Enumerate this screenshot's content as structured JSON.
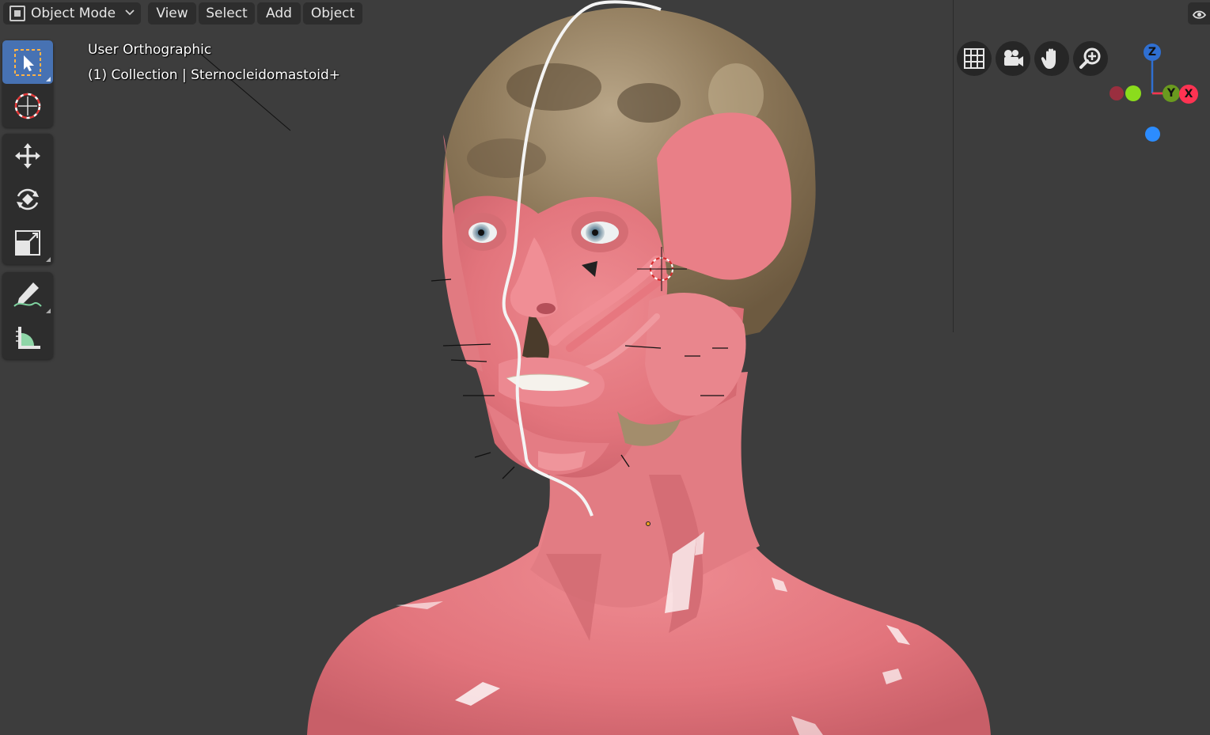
{
  "header": {
    "mode_label": "Object Mode",
    "menus": [
      "View",
      "Select",
      "Add",
      "Object"
    ]
  },
  "viewport": {
    "view_name": "User Orthographic",
    "collection_info": "(1) Collection | Sternocleidomastoid+"
  },
  "toolbar": {
    "tools": [
      {
        "name": "select-box",
        "icon": "select-box-icon",
        "active": true
      },
      {
        "name": "cursor",
        "icon": "cursor-icon",
        "active": false
      },
      {
        "name": "move",
        "icon": "move-icon",
        "active": false
      },
      {
        "name": "rotate",
        "icon": "rotate-icon",
        "active": false
      },
      {
        "name": "scale",
        "icon": "scale-icon",
        "active": false
      },
      {
        "name": "annotate",
        "icon": "annotate-icon",
        "active": false
      },
      {
        "name": "measure",
        "icon": "measure-icon",
        "active": false
      }
    ]
  },
  "navigation": {
    "buttons": [
      "grid-icon",
      "camera-icon",
      "hand-icon",
      "zoom-icon"
    ]
  },
  "gizmo": {
    "axes": [
      {
        "label": "Z",
        "color": "#2f6fd1"
      },
      {
        "label": "Y",
        "color": "#6a9a1f"
      },
      {
        "label": "X",
        "color": "#ff3352"
      }
    ],
    "neg_colors": [
      "#9a2f3f",
      "#8bdc1c",
      "#2c8cff"
    ]
  },
  "colors": {
    "background": "#3d3d3d",
    "panel": "#2d2d2d",
    "accent": "#4772b3",
    "muscle": "#e7757c",
    "bone": "#a38d6c"
  }
}
